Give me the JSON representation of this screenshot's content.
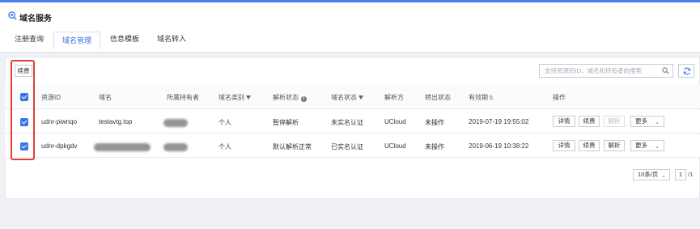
{
  "colors": {
    "accent": "#3b73e6",
    "highlight": "#d9423a",
    "topbar": "#4a7df0"
  },
  "page": {
    "title": "域名服务",
    "title_icon": "search-globe-icon"
  },
  "tabs": [
    {
      "label": "注册查询",
      "active": false
    },
    {
      "label": "域名管理",
      "active": true
    },
    {
      "label": "信息模板",
      "active": false
    },
    {
      "label": "域名转入",
      "active": false
    }
  ],
  "toolbar": {
    "renew_label": "续费",
    "search_placeholder": "支持资源短ID、域名和持有者的搜索",
    "search_icon": "search-icon",
    "refresh_icon": "refresh-icon"
  },
  "table": {
    "headers": {
      "resource_id": "资源ID",
      "domain": "域名",
      "holder": "所属持有者",
      "domain_type": "域名类别",
      "resolve_status": "解析状态",
      "domain_status": "域名状态",
      "resolver": "解析方",
      "transfer_status": "转出状态",
      "expiry": "有效期",
      "actions": "操作"
    },
    "rows": [
      {
        "checked": true,
        "resource_id": "udnr-piwnqo",
        "domain": "testavtg.top",
        "domain_type": "个人",
        "resolve_status": "暂停解析",
        "domain_status": "未实名认证",
        "resolver": "UCloud",
        "transfer_status": "未操作",
        "expiry": "2019-07-19 19:55:02",
        "actions": {
          "detail": "详情",
          "renew": "续费",
          "resolve": "解析",
          "resolve_disabled": true,
          "more": "更多"
        }
      },
      {
        "checked": true,
        "resource_id": "udnr-dpkgdv",
        "domain": "",
        "domain_type": "个人",
        "resolve_status": "默认解析正常",
        "domain_status": "已实名认证",
        "resolver": "UCloud",
        "transfer_status": "未操作",
        "expiry": "2019-06-19 10:38:22",
        "actions": {
          "detail": "详情",
          "renew": "续费",
          "resolve": "解析",
          "resolve_disabled": false,
          "more": "更多"
        }
      }
    ]
  },
  "pager": {
    "page_size": "10条/页",
    "current": "1",
    "total": "/1"
  }
}
